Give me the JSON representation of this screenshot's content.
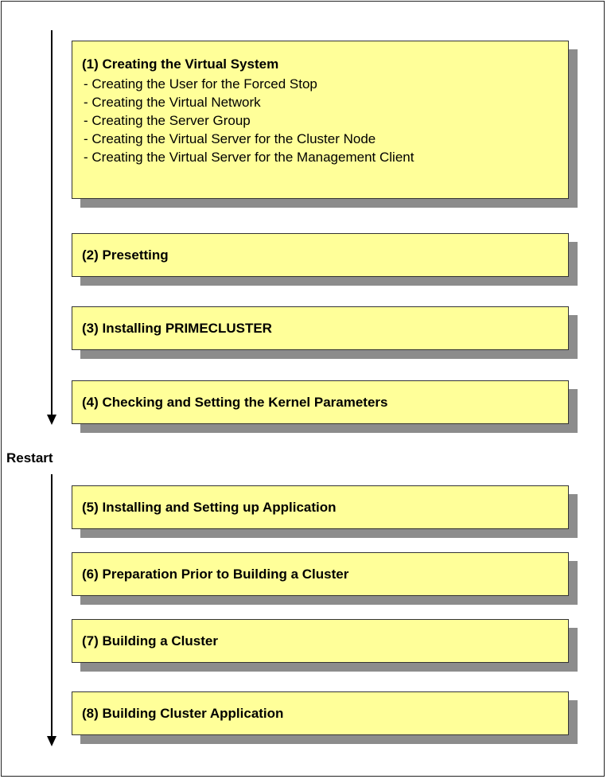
{
  "steps_before_restart": [
    {
      "title": "(1) Creating the Virtual System",
      "items": [
        "- Creating the User for the Forced Stop",
        "- Creating the Virtual Network",
        "- Creating the Server Group",
        "- Creating the Virtual Server for the Cluster Node",
        "- Creating the Virtual Server for the Management Client"
      ]
    },
    {
      "title": "(2) Presetting"
    },
    {
      "title": "(3) Installing  PRIMECLUSTER"
    },
    {
      "title": "(4) Checking  and  Setting  the  Kernel  Parameters"
    }
  ],
  "restart_label": "Restart",
  "steps_after_restart": [
    {
      "title": "(5) Installing  and  Setting  up  Application"
    },
    {
      "title": "(6) Preparation  Prior  to  Building   a  Cluster"
    },
    {
      "title": "(7) Building   a  Cluster"
    },
    {
      "title": "(8) Building   Cluster  Application"
    }
  ],
  "colors": {
    "box_fill": "#ffff99",
    "box_border": "#333333",
    "shadow": "#8c8c8c",
    "arrow": "#000000"
  }
}
